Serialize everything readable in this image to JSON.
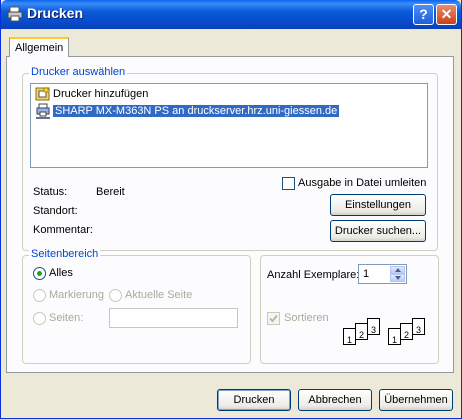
{
  "window": {
    "title": "Drucken"
  },
  "titlebar": {
    "help_glyph": "?",
    "close_glyph": "✕"
  },
  "tabs": [
    {
      "label": "Allgemein"
    }
  ],
  "printer_group": {
    "legend": "Drucker auswählen",
    "items": [
      {
        "label": "Drucker hinzufügen",
        "icon": "add-printer-icon"
      },
      {
        "label": "SHARP MX-M363N PS an druckserver.hrz.uni-giessen.de",
        "icon": "network-printer-icon",
        "selected": true
      }
    ],
    "status_label": "Status:",
    "status_value": "Bereit",
    "location_label": "Standort:",
    "comment_label": "Kommentar:",
    "print_to_file_label": "Ausgabe in Datei umleiten",
    "settings_button": "Einstellungen",
    "find_printer_button": "Drucker suchen..."
  },
  "page_range": {
    "legend": "Seitenbereich",
    "all_label": "Alles",
    "selection_label": "Markierung",
    "current_page_label": "Aktuelle Seite",
    "pages_label": "Seiten:",
    "pages_value": ""
  },
  "copies": {
    "label": "Anzahl Exemplare:",
    "value": "1",
    "collate_label": "Sortieren",
    "collated_numbers": [
      "1",
      "2",
      "3"
    ],
    "uncollated_numbers": [
      "1",
      "2",
      "3"
    ]
  },
  "footer": {
    "print_button": "Drucken",
    "cancel_button": "Abbrechen",
    "apply_button": "Übernehmen"
  },
  "colors": {
    "accent": "#0046d5",
    "selection": "#316ac5",
    "titlebar": "#0a5ad8"
  }
}
